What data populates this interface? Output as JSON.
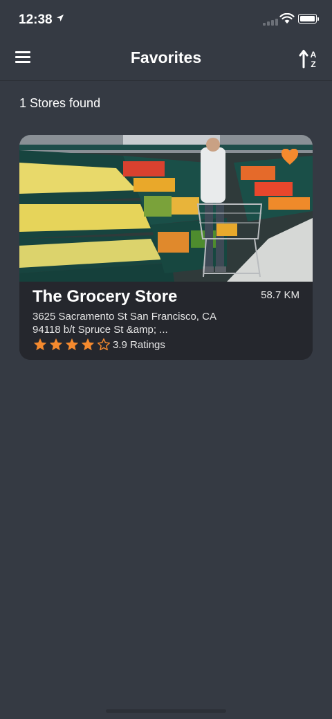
{
  "status_bar": {
    "time": "12:38"
  },
  "header": {
    "title": "Favorites"
  },
  "results": {
    "count_text": "1 Stores found"
  },
  "stores": [
    {
      "name": "The Grocery Store",
      "distance": "58.7 KM",
      "address": "3625 Sacramento St San Francisco, CA 94118 b/t Spruce St &amp; ...",
      "rating": 3.9,
      "rating_text": "3.9 Ratings",
      "favorite": true
    }
  ],
  "colors": {
    "background": "#353a43",
    "card": "#25272d",
    "accent": "#f58a2e"
  },
  "icons": {
    "menu": "hamburger-icon",
    "sort": "sort-alpha-icon",
    "favorite": "heart-icon",
    "star": "star-icon"
  }
}
